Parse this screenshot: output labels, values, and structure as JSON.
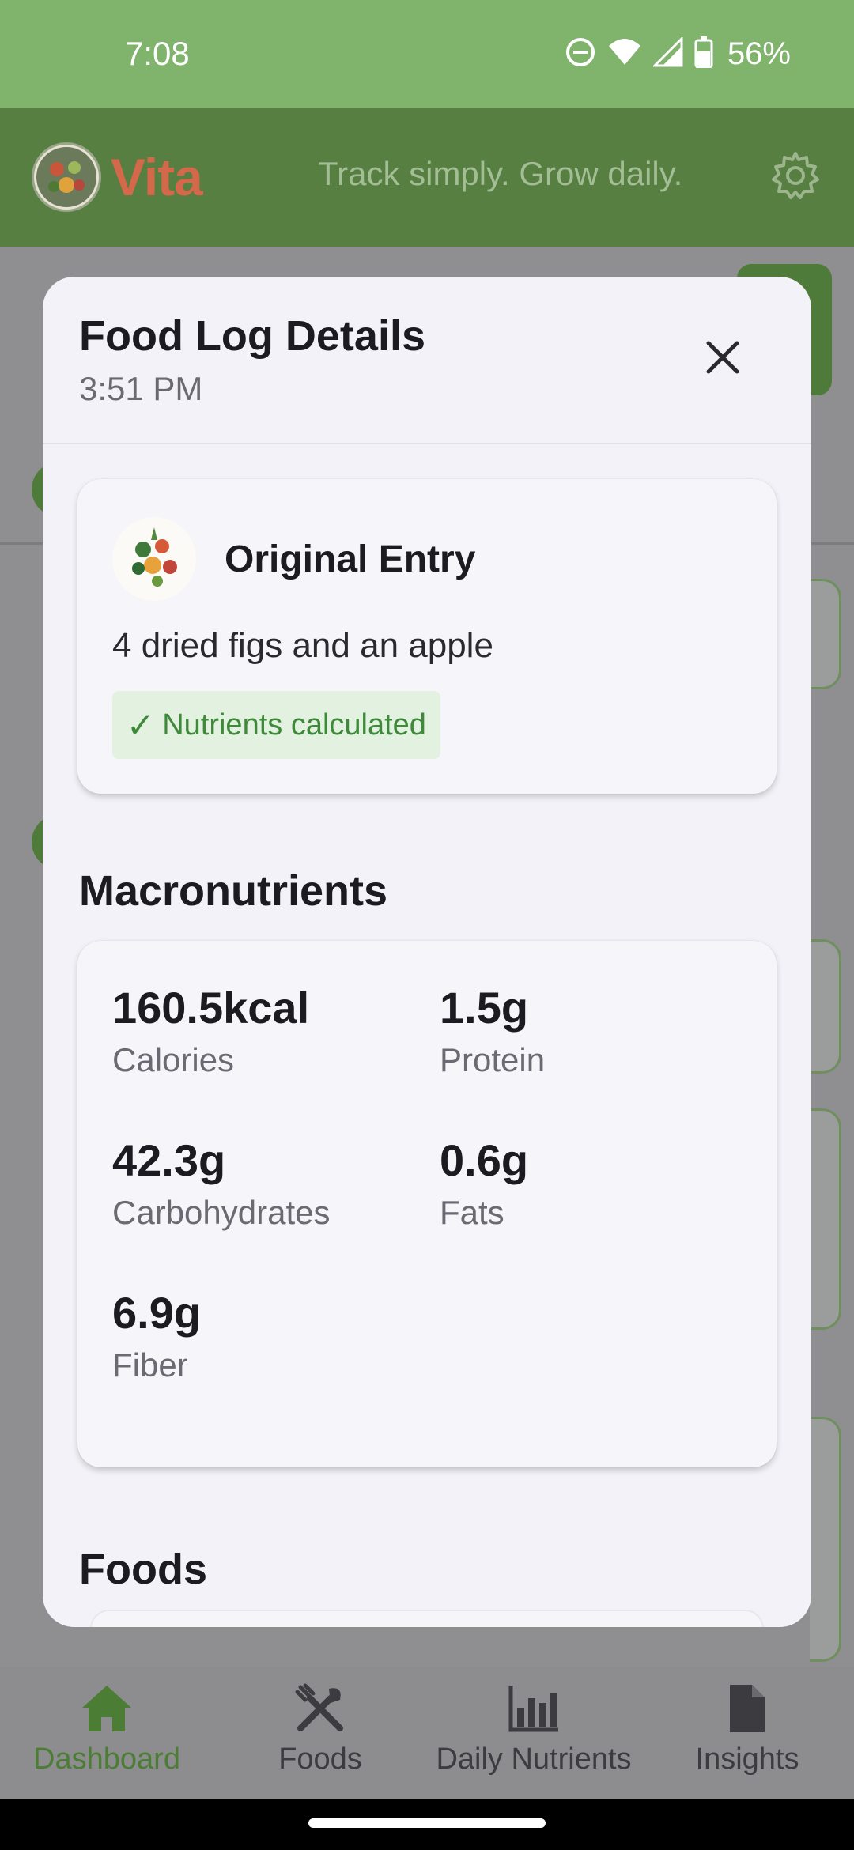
{
  "status_bar": {
    "time": "7:08",
    "battery": "56%",
    "icons": [
      "dnd-icon",
      "wifi-icon",
      "signal-icon",
      "battery-icon"
    ]
  },
  "header": {
    "app_name": "Vita",
    "tagline": "Track simply. Grow daily.",
    "settings_icon": "gear-icon"
  },
  "modal": {
    "title": "Food Log Details",
    "time": "3:51 PM",
    "close_icon": "close-icon",
    "entry": {
      "title": "Original Entry",
      "text": "4 dried figs and an apple",
      "status": "Nutrients calculated",
      "status_icon": "checkmark-icon"
    },
    "macronutrients": {
      "title": "Macronutrients",
      "items": [
        {
          "value": "160.5kcal",
          "label": "Calories"
        },
        {
          "value": "1.5g",
          "label": "Protein"
        },
        {
          "value": "42.3g",
          "label": "Carbohydrates"
        },
        {
          "value": "0.6g",
          "label": "Fats"
        },
        {
          "value": "6.9g",
          "label": "Fiber"
        }
      ]
    },
    "foods_title": "Foods"
  },
  "bottom_nav": {
    "items": [
      {
        "label": "Dashboard",
        "icon": "home-icon",
        "active": true
      },
      {
        "label": "Foods",
        "icon": "utensils-icon",
        "active": false
      },
      {
        "label": "Daily Nutrients",
        "icon": "bar-chart-icon",
        "active": false
      },
      {
        "label": "Insights",
        "icon": "document-icon",
        "active": false
      }
    ]
  },
  "colors": {
    "status_bar": "#80b36c",
    "header": "#567f41",
    "accent_green": "#4b7d35",
    "app_name": "#d4684a",
    "badge_bg": "#e3f1e1",
    "badge_text": "#3f8a3a"
  }
}
